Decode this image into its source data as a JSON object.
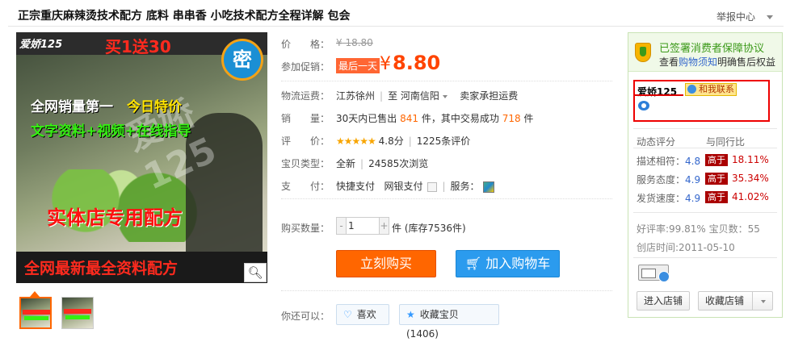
{
  "title": "正宗重庆麻辣烫技术配方 底料 串串香 小吃技术配方全程详解 包会",
  "report": "举报中心",
  "image": {
    "brand": "爱娇125",
    "promo": "买1送30",
    "seal": "密",
    "line1_a": "全网销量第一",
    "line1_b": "今日特价",
    "line2": "文字资料+视频+在线指导",
    "line3": "实体店专用配方",
    "line4": "全网最新最全资料配方",
    "watermark": "爱娇125"
  },
  "zoom_icon": "magnifier-icon",
  "labels": {
    "price": "价　　格：",
    "promo": "参加促销：",
    "shipping": "物流运费：",
    "sales": "销　　量：",
    "rating": "评　　价：",
    "type": "宝贝类型：",
    "pay": "支　　付：",
    "qty": "购买数量：",
    "more": "你还可以："
  },
  "price": {
    "original": "¥ 18.80",
    "badge": "最后一天",
    "yen": "¥",
    "current": "8.80"
  },
  "shipping": {
    "from": "江苏徐州",
    "to_label": "至",
    "to": "河南信阳",
    "fee": "卖家承担运费"
  },
  "sales": {
    "prefix": "30天内已售出",
    "sold": "841",
    "unit1": "件，其中交易成功",
    "success": "718",
    "unit2": "件"
  },
  "rating": {
    "stars": "★★★★★",
    "score": "4.8分",
    "count": "1225条评价"
  },
  "type": {
    "condition": "全新",
    "views": "24585次浏览"
  },
  "pay": {
    "m1": "快捷支付",
    "m2": "网银支付",
    "service": "服务："
  },
  "qty": {
    "value": "1",
    "minus": "-",
    "plus": "+",
    "stock": "件 (库存7536件)"
  },
  "buttons": {
    "buy": "立刻购买",
    "cart": "加入购物车",
    "like": "喜欢",
    "fav": "收藏宝贝 (1406)"
  },
  "panel": {
    "title": "已签署消费者保障协议",
    "sub_a": "查看",
    "sub_link": "购物须知",
    "sub_b": "明确售后权益",
    "seller": "爱娇125",
    "contact": "和我联系",
    "dyn": "动态评分",
    "compare": "与同行比",
    "r1_label": "描述相符：",
    "r1_val": "4.8",
    "r1_tag": "高于",
    "r1_pct": "18.11%",
    "r2_label": "服务态度：",
    "r2_val": "4.9",
    "r2_tag": "高于",
    "r2_pct": "35.34%",
    "r3_label": "发货速度：",
    "r3_val": "4.9",
    "r3_tag": "高于",
    "r3_pct": "41.02%",
    "goodrate": "好评率:99.81%  宝贝数：55",
    "created": "创店时间:2011-05-10",
    "enter": "进入店铺",
    "collect": "收藏店铺"
  },
  "colors": {
    "accent": "#ff6600",
    "price": "#ff4400",
    "blue": "#2b9bee",
    "green": "#3c9a1a",
    "red_box": "#ee0000"
  }
}
